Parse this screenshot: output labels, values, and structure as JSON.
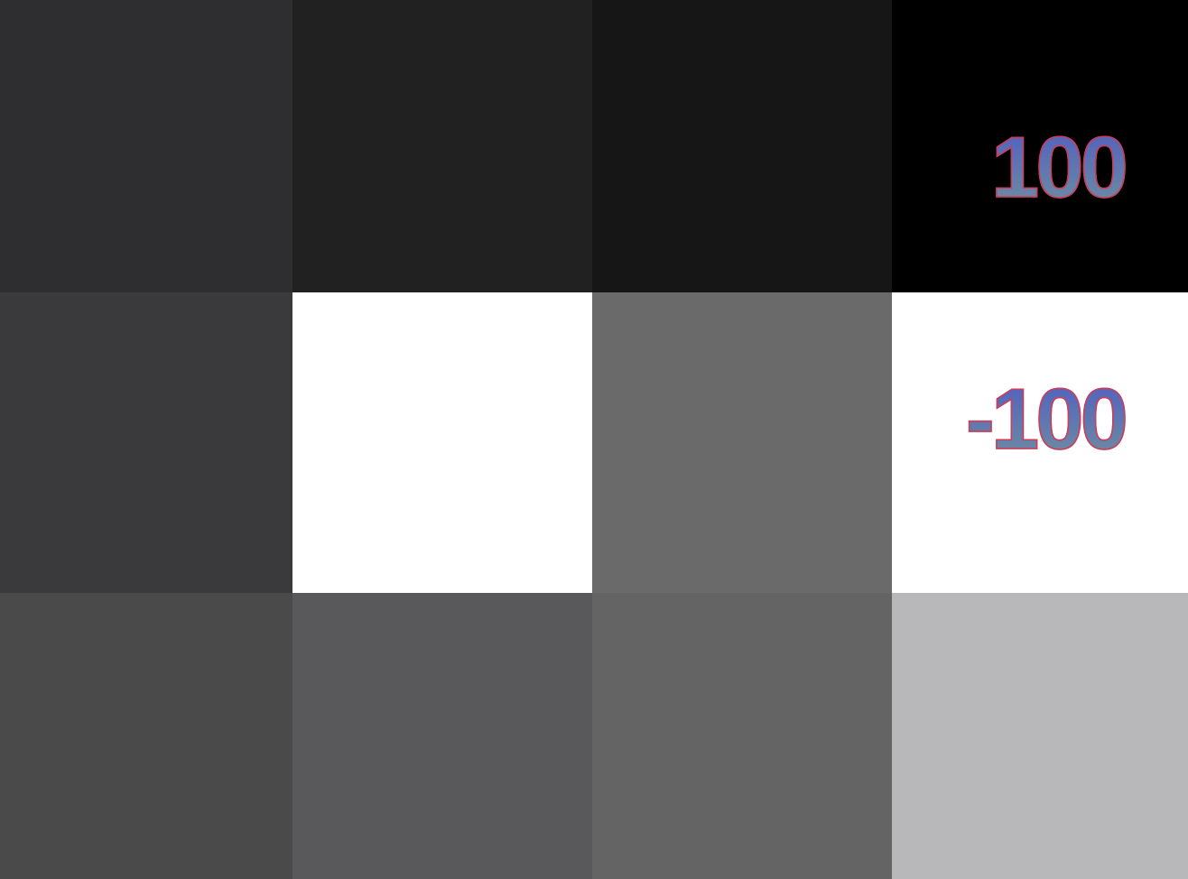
{
  "tiles": [
    {
      "name": "tile-r1-c1",
      "row": 0,
      "col": 0,
      "color": "#2e2d30",
      "label": ""
    },
    {
      "name": "tile-r1-c2",
      "row": 0,
      "col": 1,
      "color": "#212122",
      "label": ""
    },
    {
      "name": "tile-r1-c3",
      "row": 0,
      "col": 2,
      "color": "#161617",
      "label": ""
    },
    {
      "name": "tile-r1-c4",
      "row": 0,
      "col": 3,
      "color": "#000000",
      "label": "100"
    },
    {
      "name": "tile-r2-c1",
      "row": 1,
      "col": 0,
      "color": "#3a393b",
      "label": ""
    },
    {
      "name": "tile-r2-c2",
      "row": 1,
      "col": 1,
      "color": "#ffffff",
      "label": ""
    },
    {
      "name": "tile-r2-c3",
      "row": 1,
      "col": 2,
      "color": "#6a6a6a",
      "label": ""
    },
    {
      "name": "tile-r2-c4",
      "row": 1,
      "col": 3,
      "color": "#ffffff",
      "label": "-100"
    },
    {
      "name": "tile-r3-c1",
      "row": 2,
      "col": 0,
      "color": "#4a4a4b",
      "label": ""
    },
    {
      "name": "tile-r3-c2",
      "row": 2,
      "col": 1,
      "color": "#59595b",
      "label": ""
    },
    {
      "name": "tile-r3-c3",
      "row": 2,
      "col": 2,
      "color": "#646464",
      "label": ""
    },
    {
      "name": "tile-r3-c4",
      "row": 2,
      "col": 3,
      "color": "#b8b7ba",
      "label": ""
    }
  ],
  "labels": {
    "top_right": "100",
    "middle_right": "-100"
  },
  "colors": {
    "label_fill_top": "#4f5fc0",
    "label_fill_bottom": "#6f8ea0",
    "label_outline": "#d23a55"
  }
}
